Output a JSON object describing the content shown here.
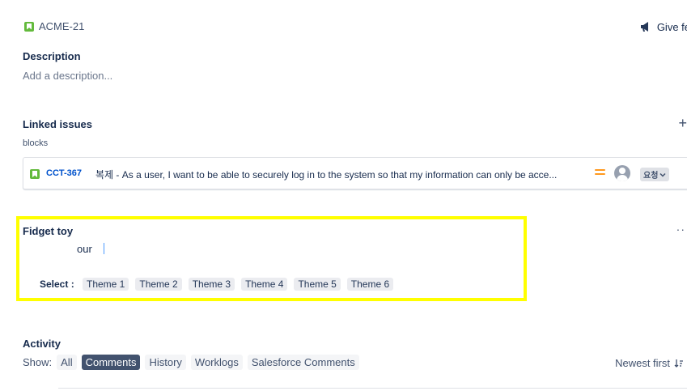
{
  "issue": {
    "key": "ACME-21",
    "feedback_label": "Give fe"
  },
  "description": {
    "label": "Description",
    "placeholder": "Add a description..."
  },
  "linked_issues": {
    "label": "Linked issues",
    "add_icon": "plus-icon",
    "relation": "blocks",
    "items": [
      {
        "key": "CCT-367",
        "summary": "복제 - As a user, I want to be able to securely log in to the system so that my information can only be acce...",
        "priority_icon": "priority-medium-icon",
        "status": "요청"
      }
    ]
  },
  "fidget": {
    "label": "Fidget toy",
    "value": "our",
    "select_label": "Select :",
    "themes": [
      "Theme 1",
      "Theme 2",
      "Theme 3",
      "Theme 4",
      "Theme 5",
      "Theme 6"
    ]
  },
  "activity": {
    "label": "Activity",
    "show_label": "Show:",
    "tabs": [
      "All",
      "Comments",
      "History",
      "Worklogs",
      "Salesforce Comments"
    ],
    "active_tab": "Comments",
    "sort_label": "Newest first"
  },
  "colors": {
    "highlight": "#ffff00",
    "story": "#63ba3c",
    "link": "#0052cc",
    "priority": "#ff991f"
  }
}
